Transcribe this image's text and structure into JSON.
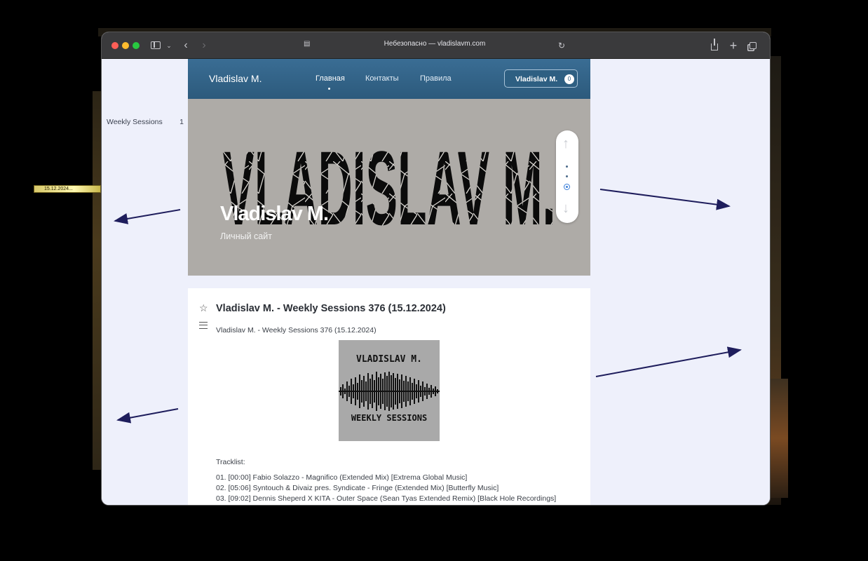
{
  "window": {
    "address_text": "Небезопасно — vladislavm.com"
  },
  "date_tag": "15.12.2024...",
  "sidebar": {
    "categories": [
      {
        "label": "Weekly Sessions",
        "count": "1"
      }
    ]
  },
  "header": {
    "logo": "Vladislav M.",
    "nav": [
      "Главная",
      "Контакты",
      "Правила"
    ],
    "user_button": {
      "label": "Vladislav M.",
      "badge": "0"
    }
  },
  "hero": {
    "banner_art_text": "VLADISLAV M.",
    "title": "Vladislav M.",
    "subtitle": "Личный сайт"
  },
  "post": {
    "title": "Vladislav M. - Weekly Sessions 376 (15.12.2024)",
    "subtitle": "Vladislav M. - Weekly Sessions 376 (15.12.2024)",
    "cover": {
      "top_text": "VLADISLAV M.",
      "bottom_text": "WEEKLY SESSIONS"
    },
    "tracklist_label": "Tracklist:",
    "tracks": [
      "01. [00:00] Fabio Solazzo - Magnifico (Extended Mix) [Extrema Global Music]",
      "02. [05:06] Syntouch & Divaiz pres. Syndicate - Fringe (Extended Mix) [Butterfly Music]",
      "03. [09:02] Dennis Sheperd X KITA - Outer Space (Sean Tyas Extended Remix) [Black Hole Recordings]"
    ]
  },
  "colors": {
    "header_blue": "#2c5a7c",
    "page_background": "#eef0fb",
    "hero_grey": "#aeaba7",
    "arrow_navy": "#1e1d5c"
  }
}
